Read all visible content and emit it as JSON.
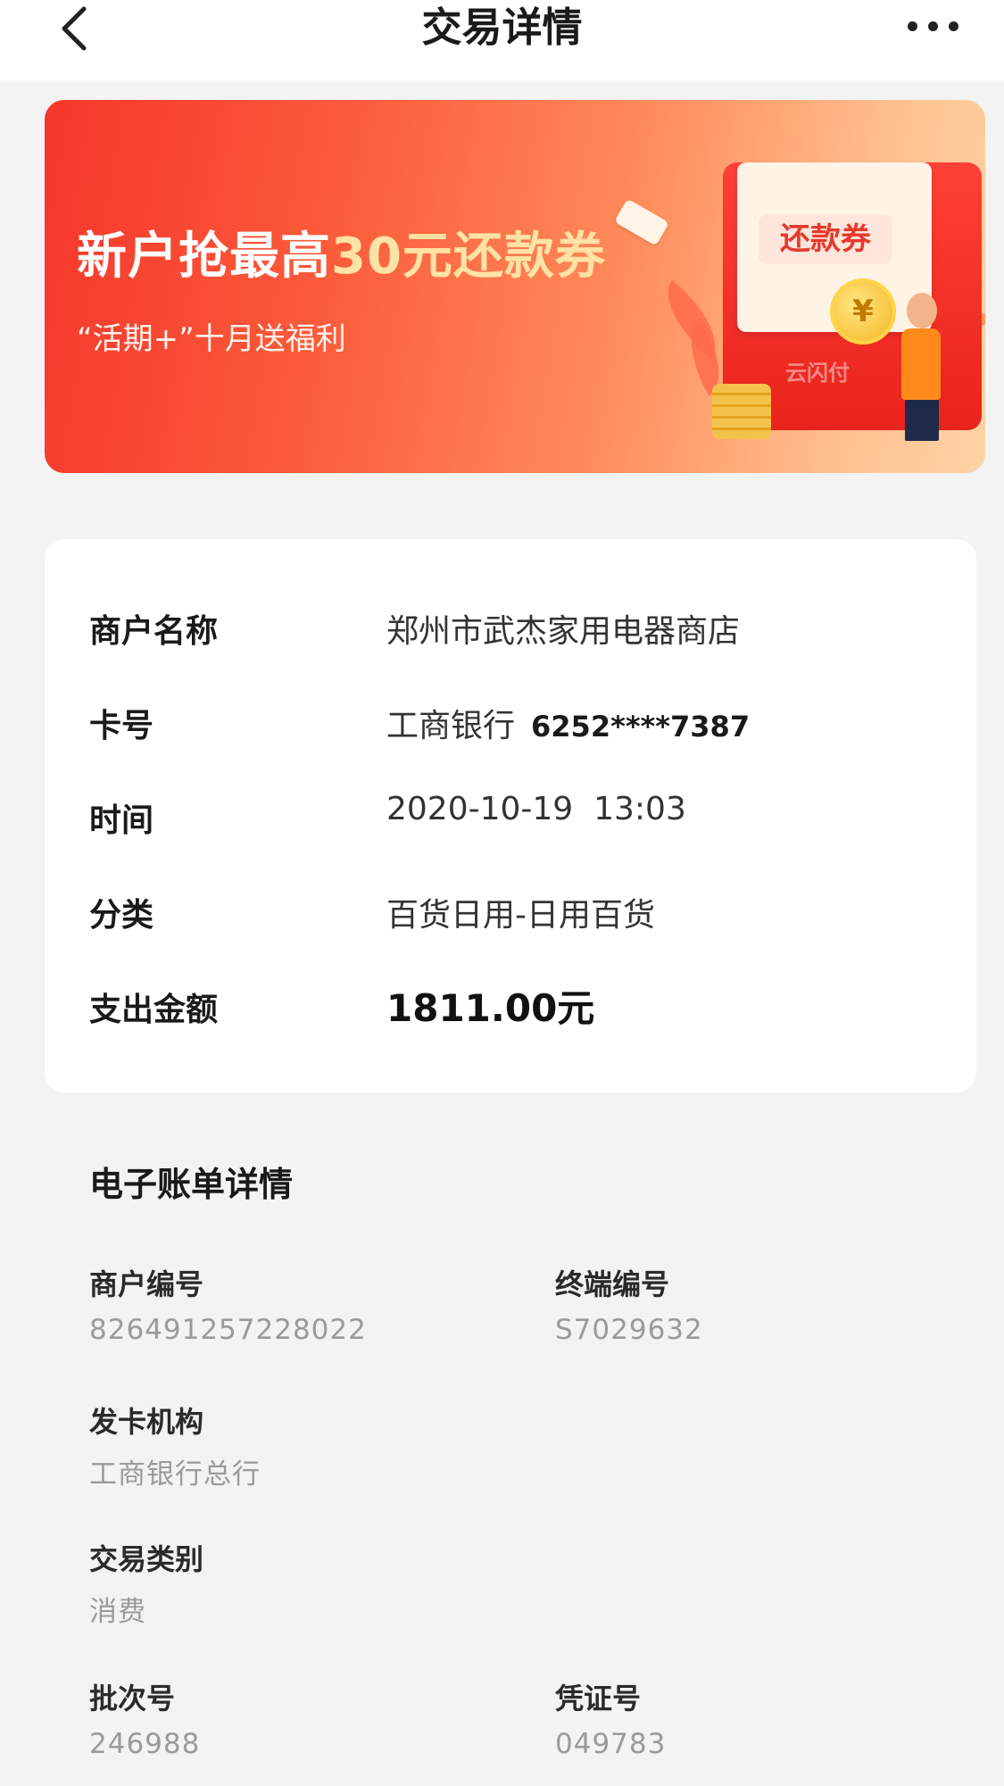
{
  "header": {
    "title": "交易详情",
    "back_icon": "chevron-left-icon",
    "more_icon": "more-dots-icon"
  },
  "banner": {
    "headline_part1": "新户抢最高",
    "headline_highlight": "30元还款券",
    "subtitle": "“活期+”十月送福利",
    "coupon_text": "还款券",
    "coin_symbol": "¥",
    "brand_text": "云闪付",
    "colors": {
      "start": "#f5362c",
      "end": "#ffd3a4",
      "highlight": "#ffe3a3"
    }
  },
  "transaction": {
    "merchant_label": "商户名称",
    "merchant_value": "郑州市武杰家用电器商店",
    "card_label": "卡号",
    "card_bank": "工商银行",
    "card_number": "6252****7387",
    "time_label": "时间",
    "time_value": "2020-10-19  13:03",
    "category_label": "分类",
    "category_value": "百货日用-日用百货",
    "amount_label": "支出金额",
    "amount_value": "1811.00元"
  },
  "ebill": {
    "title": "电子账单详情",
    "merchant_no_label": "商户编号",
    "merchant_no_value": "826491257228022",
    "terminal_no_label": "终端编号",
    "terminal_no_value": "S7029632",
    "issuer_label": "发卡机构",
    "issuer_value": "工商银行总行",
    "type_label": "交易类别",
    "type_value": "消费",
    "batch_label": "批次号",
    "batch_value": "246988",
    "voucher_label": "凭证号",
    "voucher_value": "049783"
  }
}
